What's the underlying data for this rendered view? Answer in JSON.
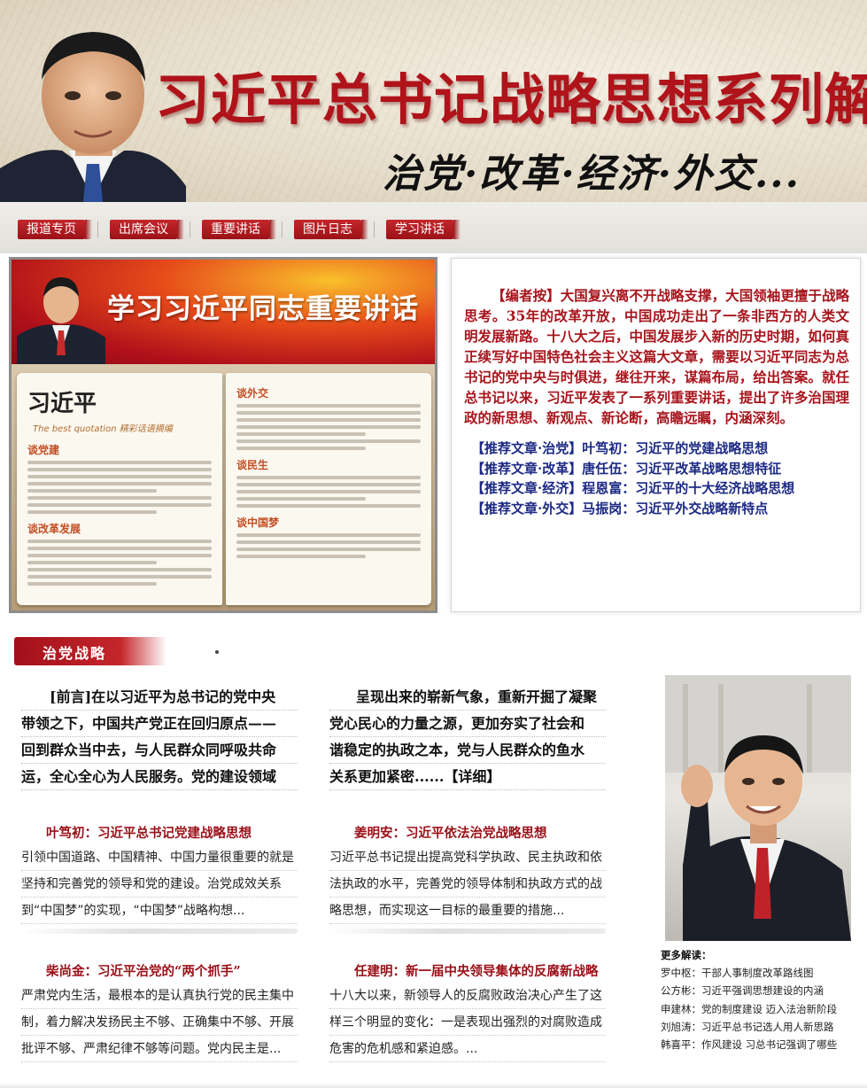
{
  "banner": {
    "title": "习近平总书记战略思想系列解读",
    "subtitle": "治党·改革·经济·外交..."
  },
  "nav": {
    "items": [
      {
        "label": "报道专页"
      },
      {
        "label": "出席会议"
      },
      {
        "label": "重要讲话"
      },
      {
        "label": "图片日志"
      },
      {
        "label": "学习讲话"
      }
    ]
  },
  "feature": {
    "image_heading": "学习习近平同志重要讲话",
    "book": {
      "title": "习近平",
      "subtitle": "The best quotation 精彩话语摘编",
      "headings_left": [
        "谈党建",
        "谈改革发展"
      ],
      "headings_right": [
        "谈外交",
        "谈民生",
        "谈中国梦"
      ]
    },
    "editor_note": "【编者按】大国复兴离不开战略支撑，大国领袖更擅于战略思考。35年的改革开放，中国成功走出了一条非西方的人类文明发展新路。十八大之后，中国发展步入新的历史时期，如何真正续写好中国特色社会主义这篇大文章，需要以习近平同志为总书记的党中央与时俱进，继往开来，谋篇布局，给出答案。就任总书记以来，习近平发表了一系列重要讲话，提出了许多治国理政的新思想、新观点、新论断，高瞻远瞩，内涵深刻。",
    "recommended": [
      "【推荐文章·治党】叶笃初：习近平的党建战略思想",
      "【推荐文章·改革】唐任伍：习近平改革战略思想特征",
      "【推荐文章·经济】程恩富：习近平的十大经济战略思想",
      "【推荐文章·外交】马振岗：习近平外交战略新特点"
    ]
  },
  "section": {
    "tag": "治党战略",
    "lead_left": [
      "[前言]在以习近平为总书记的党中央",
      "带领之下，中国共产党正在回归原点——",
      "回到群众当中去，与人民群众同呼吸共命",
      "运，全心全心为人民服务。党的建设领域"
    ],
    "lead_right": [
      "呈现出来的崭新气象，重新开掘了凝聚",
      "党心民心的力量之源，更加夯实了社会和",
      "谐稳定的执政之本，党与人民群众的鱼水",
      "关系更加紧密......【详细】"
    ],
    "cards": [
      {
        "title": "叶笃初：习近平总书记党建战略思想",
        "lines": [
          "引领中国道路、中国精神、中国力量很重要的就是",
          "坚持和完善党的领导和党的建设。治党成效关系",
          "到“中国梦”的实现，“中国梦”战略构想..."
        ]
      },
      {
        "title": "姜明安：习近平依法治党战略思想",
        "lines": [
          "习近平总书记提出提高党科学执政、民主执政和依",
          "法执政的水平，完善党的领导体制和执政方式的战",
          "略思想，而实现这一目标的最重要的措施..."
        ]
      },
      {
        "title": "柴尚金：习近平治党的“两个抓手”",
        "lines": [
          "严肃党内生活，最根本的是认真执行党的民主集中",
          "制，着力解决发扬民主不够、正确集中不够、开展",
          "批评不够、严肃纪律不够等问题。党内民主是..."
        ]
      },
      {
        "title": "任建明：新一届中央领导集体的反腐新战略",
        "lines": [
          "十八大以来，新领导人的反腐败政治决心产生了这",
          "样三个明显的变化：一是表现出强烈的对腐败造成",
          "危害的危机感和紧迫感。..."
        ]
      }
    ],
    "more_label": "更多解读：",
    "more_items": [
      "罗中枢：干部人事制度改革路线图",
      "公方彬：习近平强调思想建设的内涵",
      "申建林：党的制度建设 迈入法治新阶段",
      "刘旭涛：习近平总书记选人用人新思路",
      "韩喜平：作风建设 习总书记强调了哪些"
    ]
  }
}
